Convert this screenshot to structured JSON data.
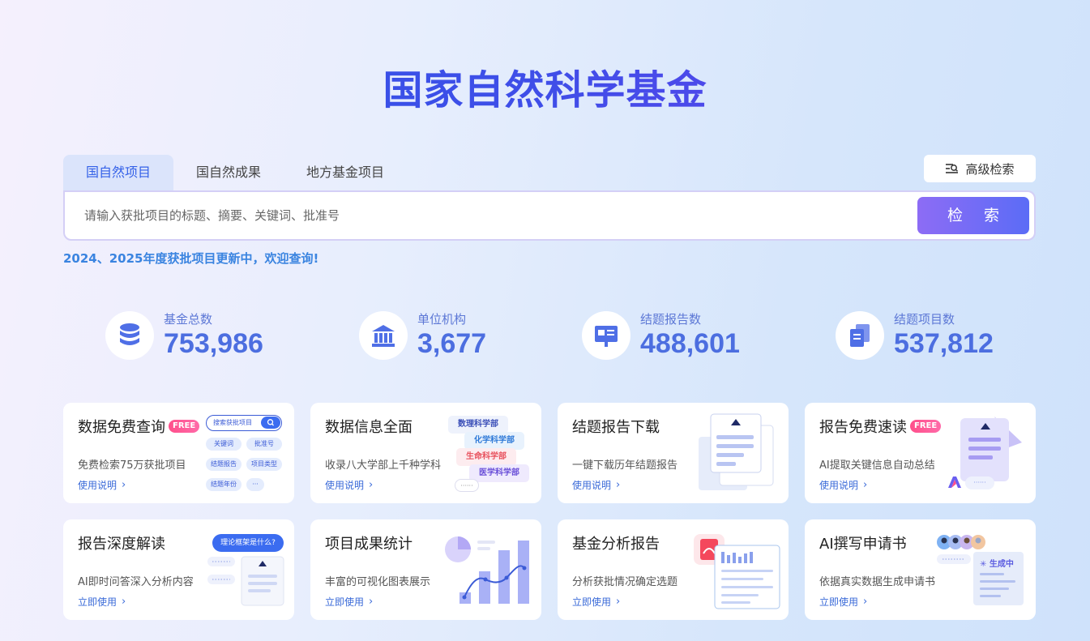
{
  "title": "国家自然科学基金",
  "tabs": [
    {
      "label": "国自然项目"
    },
    {
      "label": "国自然成果"
    },
    {
      "label": "地方基金项目"
    }
  ],
  "advanced_search": {
    "label": "高级检索"
  },
  "search": {
    "placeholder": "请输入获批项目的标题、摘要、关键词、批准号",
    "button": "检 索"
  },
  "notice": "2024、2025年度获批项目更新中，欢迎查询!",
  "stats": [
    {
      "label": "基金总数",
      "value": "753,986",
      "icon": "database-icon"
    },
    {
      "label": "单位机构",
      "value": "3,677",
      "icon": "institution-icon"
    },
    {
      "label": "结题报告数",
      "value": "488,601",
      "icon": "report-board-icon"
    },
    {
      "label": "结题项目数",
      "value": "537,812",
      "icon": "documents-icon"
    }
  ],
  "cards": [
    {
      "title": "数据免费查询",
      "badge": "FREE",
      "desc": "免费检索75万获批项目",
      "link": "使用说明",
      "deco": {
        "search_label": "搜索获批项目",
        "pills": [
          "关键词",
          "批准号",
          "结题报告",
          "项目类型",
          "结题年份",
          "···"
        ]
      }
    },
    {
      "title": "数据信息全面",
      "desc": "收录八大学部上千种学科",
      "link": "使用说明",
      "deco": {
        "tags": [
          "数理科学部",
          "化学科学部",
          "生命科学部",
          "医学科学部"
        ],
        "more": "······"
      }
    },
    {
      "title": "结题报告下载",
      "desc": "一键下载历年结题报告",
      "link": "使用说明"
    },
    {
      "title": "报告免费速读",
      "badge": "FREE",
      "desc": "AI提取关键信息自动总结",
      "link": "使用说明",
      "deco": {
        "dots": "······"
      }
    },
    {
      "title": "报告深度解读",
      "desc": "AI即时问答深入分析内容",
      "link": "立即使用",
      "deco": {
        "bubble": "理论框架是什么?"
      }
    },
    {
      "title": "项目成果统计",
      "desc": "丰富的可视化图表展示",
      "link": "立即使用"
    },
    {
      "title": "基金分析报告",
      "desc": "分析获批情况确定选题",
      "link": "立即使用"
    },
    {
      "title": "AI撰写申请书",
      "desc": "依据真实数据生成申请书",
      "link": "立即使用",
      "deco": {
        "status": "生成中"
      }
    }
  ],
  "colors": {
    "accent": "#3461e8",
    "stat": "#4c6ee0",
    "badge": "#ff4f8b",
    "notice": "#3a84e0"
  }
}
